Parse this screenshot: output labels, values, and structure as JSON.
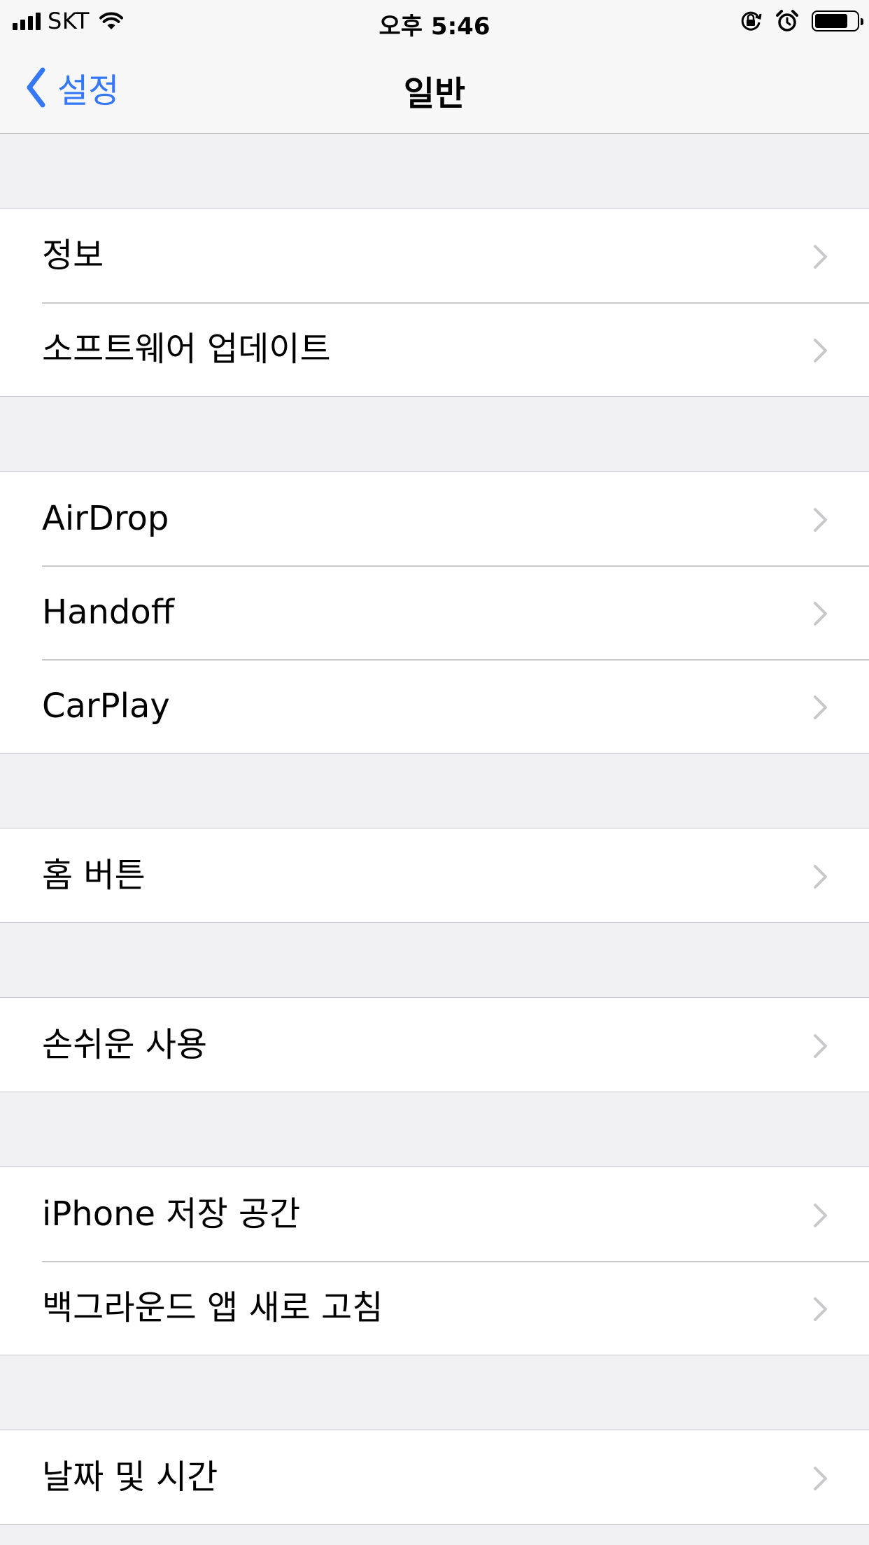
{
  "status_bar": {
    "carrier": "SKT",
    "time": "오후 5:46",
    "battery_level": 0.8,
    "icons": [
      "cellular-signal-icon",
      "wifi-icon",
      "orientation-lock-icon",
      "alarm-icon",
      "battery-icon"
    ]
  },
  "nav": {
    "back_label": "설정",
    "title": "일반"
  },
  "colors": {
    "accent": "#3478f6",
    "grouped_background": "#efeff4",
    "cell_background": "#ffffff",
    "separator": "#c8c7cc",
    "chevron": "#c7c7cc"
  },
  "groups": [
    {
      "items": [
        {
          "label": "정보"
        },
        {
          "label": "소프트웨어 업데이트"
        }
      ]
    },
    {
      "items": [
        {
          "label": "AirDrop"
        },
        {
          "label": "Handoff"
        },
        {
          "label": "CarPlay"
        }
      ]
    },
    {
      "items": [
        {
          "label": "홈 버튼"
        }
      ]
    },
    {
      "items": [
        {
          "label": "손쉬운 사용"
        }
      ]
    },
    {
      "items": [
        {
          "label": "iPhone 저장 공간"
        },
        {
          "label": "백그라운드 앱 새로 고침"
        }
      ]
    },
    {
      "items": [
        {
          "label": "날짜 및 시간"
        }
      ]
    }
  ]
}
